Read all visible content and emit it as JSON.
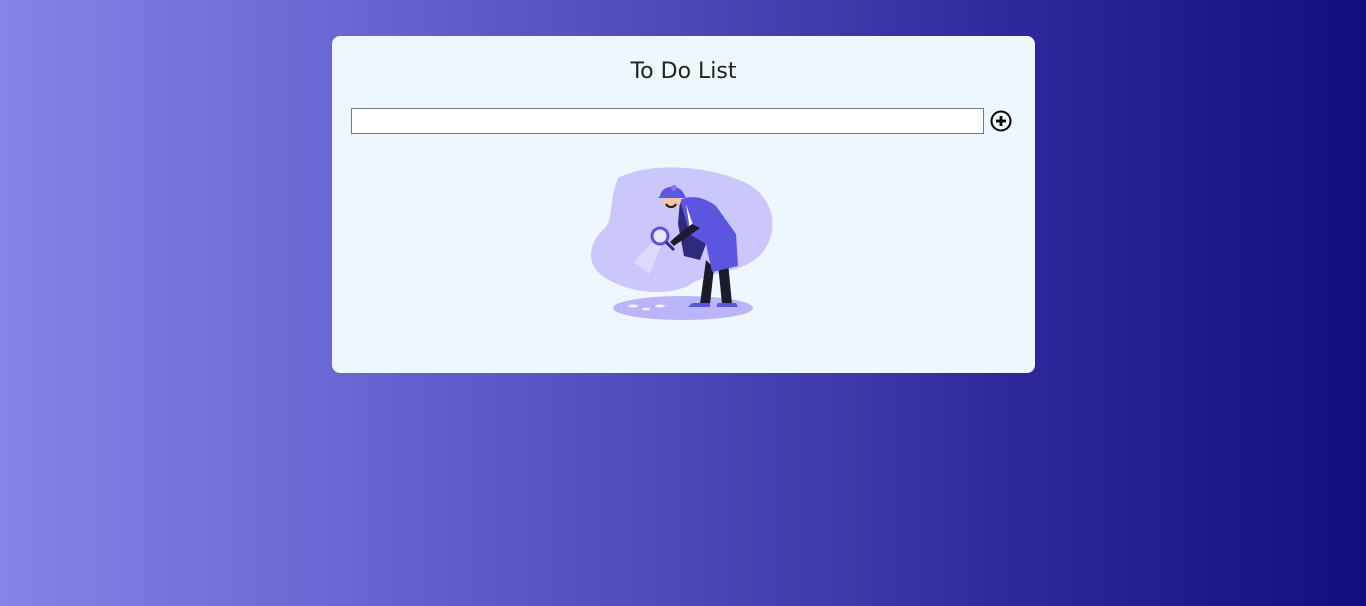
{
  "app": {
    "title": "To Do List"
  },
  "todo_input": {
    "value": "",
    "placeholder": ""
  },
  "icons": {
    "add": "plus-circle-icon",
    "empty_state": "detective-magnifier-illustration"
  },
  "colors": {
    "card_bg": "#eff7fe",
    "gradient_start": "#8683e6",
    "gradient_end": "#110e7f",
    "illustration_accent": "#5b55e0"
  }
}
